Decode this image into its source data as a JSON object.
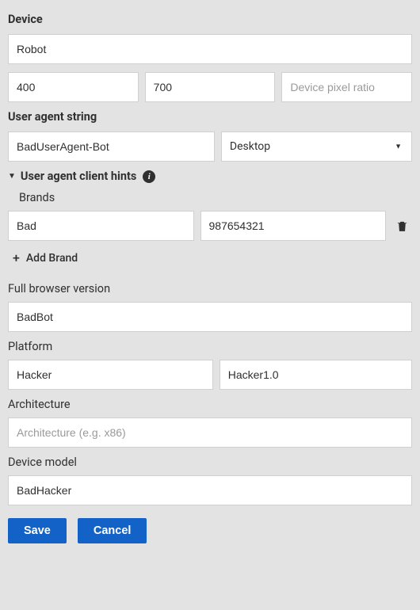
{
  "device": {
    "heading": "Device",
    "name": "Robot",
    "width": "400",
    "height": "700",
    "pixel_ratio": "",
    "pixel_ratio_placeholder": "Device pixel ratio"
  },
  "user_agent": {
    "heading": "User agent string",
    "value": "BadUserAgent-Bot",
    "type": "Desktop"
  },
  "client_hints": {
    "heading": "User agent client hints",
    "brands_label": "Brands",
    "brand": {
      "name": "Bad",
      "version": "987654321"
    },
    "add_brand_label": "Add Brand",
    "full_browser_version_label": "Full browser version",
    "full_browser_version": "BadBot",
    "platform_label": "Platform",
    "platform": "Hacker",
    "platform_version": "Hacker1.0",
    "architecture_label": "Architecture",
    "architecture": "",
    "architecture_placeholder": "Architecture (e.g. x86)",
    "device_model_label": "Device model",
    "device_model": "BadHacker"
  },
  "actions": {
    "save": "Save",
    "cancel": "Cancel"
  },
  "icons": {
    "info": "i",
    "collapse": "▼",
    "plus": "+"
  }
}
